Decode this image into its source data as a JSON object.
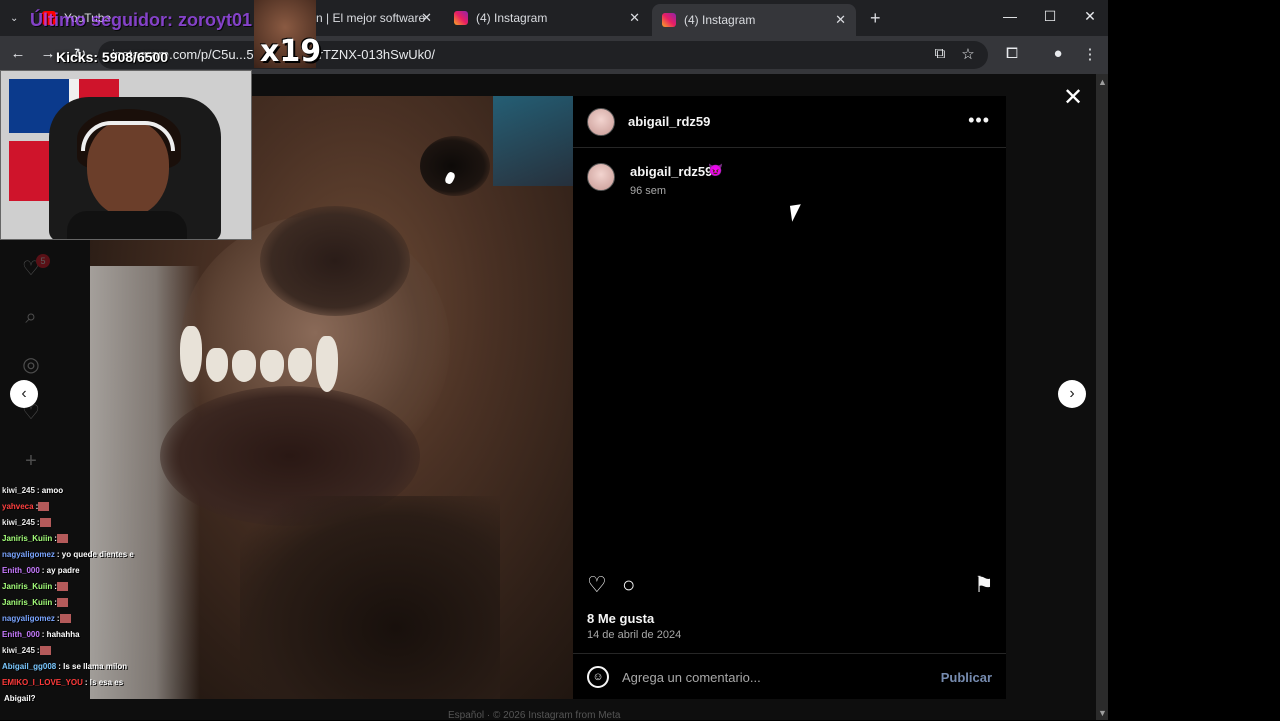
{
  "browser": {
    "tabs": [
      {
        "label": "YouTube",
        "active": false
      },
      {
        "label": "n | El mejor software",
        "active": false
      },
      {
        "label": "(4) Instagram",
        "active": false
      },
      {
        "label": "(4) Instagram",
        "active": true
      }
    ],
    "new_tab": "+",
    "address": "instagram.com/p/C5u...5kx3lvSalxGrTZNX-013hSwUk0/"
  },
  "stream": {
    "last_follower": "Último seguidor: zoroyt01",
    "kicks": "Kicks: 5908/6500",
    "gif_counter": "x19",
    "chat": [
      {
        "user": "kiwi_245",
        "msg": ": amoo",
        "color": "#e8e8e8"
      },
      {
        "user": "yahveca",
        "msg": ":",
        "color": "#ff4040"
      },
      {
        "user": "kiwi_245",
        "msg": ":",
        "color": "#e8e8e8"
      },
      {
        "user": "Janiris_Kuiin",
        "msg": ":",
        "color": "#a4ff7a"
      },
      {
        "user": "nagyaligomez",
        "msg": ": yo quede dientes e",
        "color": "#7aa5ff"
      },
      {
        "user": "Enith_000",
        "msg": ": ay padre",
        "color": "#c77aff"
      },
      {
        "user": "Janiris_Kuiin",
        "msg": ":",
        "color": "#a4ff7a"
      },
      {
        "user": "Janiris_Kuiin",
        "msg": ":",
        "color": "#a4ff7a"
      },
      {
        "user": "nagyaligomez",
        "msg": ":",
        "color": "#7aa5ff"
      },
      {
        "user": "Enith_000",
        "msg": ": hahahha",
        "color": "#c77aff"
      },
      {
        "user": "kiwi_245",
        "msg": ":",
        "color": "#e8e8e8"
      },
      {
        "user": "Abigail_gg008",
        "msg": ": Is se llama milon",
        "color": "#7ac8ff"
      },
      {
        "user": "EMIKO_I_LOVE_YOU",
        "msg": ": Is esa es",
        "color": "#ff3a3a"
      },
      {
        "user": "",
        "msg": "Abigail?",
        "color": "#ffffff"
      }
    ]
  },
  "nav": {
    "notifications_badge": "5"
  },
  "post": {
    "author": "abigail_rdz59",
    "caption_author": "abigail_rdz59",
    "caption_emoji": "😈",
    "time_ago": "96 sem",
    "more": "•••",
    "likes": "8 Me gusta",
    "date": "14 de abril de 2024",
    "comment_placeholder": "Agrega un comentario...",
    "publish_label": "Publicar"
  },
  "footer": {
    "text": "Español  ·  © 2026 Instagram from Meta"
  },
  "icons": {
    "close": "✕",
    "prev": "‹",
    "next": "›"
  }
}
